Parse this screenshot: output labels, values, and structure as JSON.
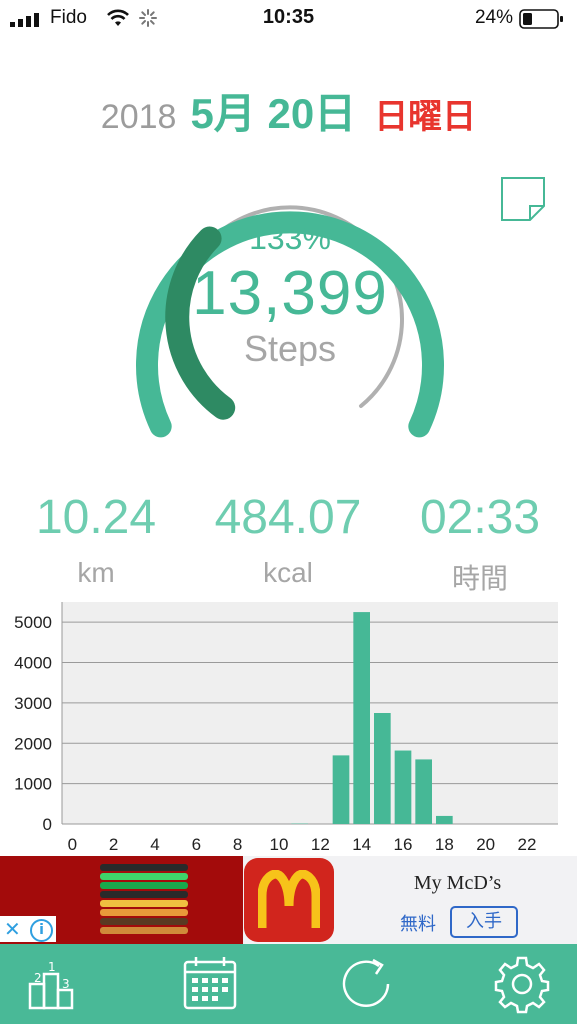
{
  "status_bar": {
    "carrier": "Fido",
    "time": "10:35",
    "battery": "24%"
  },
  "header": {
    "year": "2018",
    "month_day": "5月 20日",
    "weekday": "日曜日"
  },
  "gauge": {
    "percent": "133%",
    "steps": "13,399",
    "steps_label": "Steps",
    "progress": 1.33
  },
  "stats": {
    "distance": {
      "value": "10.24",
      "unit": "km"
    },
    "calories": {
      "value": "484.07",
      "unit": "kcal"
    },
    "duration": {
      "value": "02:33",
      "unit": "時間"
    }
  },
  "chart_data": {
    "type": "bar",
    "x": [
      0,
      1,
      2,
      3,
      4,
      5,
      6,
      7,
      8,
      9,
      10,
      11,
      12,
      13,
      14,
      15,
      16,
      17,
      18,
      19,
      20,
      21,
      22,
      23
    ],
    "values": [
      0,
      0,
      0,
      0,
      0,
      0,
      0,
      0,
      0,
      0,
      0,
      10,
      0,
      1700,
      5250,
      2750,
      1820,
      1600,
      200,
      0,
      0,
      0,
      0,
      0
    ],
    "x_ticks": [
      "0",
      "2",
      "4",
      "6",
      "8",
      "10",
      "12",
      "14",
      "16",
      "18",
      "20",
      "22"
    ],
    "y_ticks": [
      "0",
      "1000",
      "2000",
      "3000",
      "4000",
      "5000"
    ],
    "ylim": [
      0,
      5500
    ],
    "grid": true,
    "bar_color": "#46b896"
  },
  "ad": {
    "title": "My McD’s",
    "free_label": "無料",
    "install_label": "入手"
  },
  "tabs": [
    {
      "icon": "ranking-icon"
    },
    {
      "icon": "calendar-icon"
    },
    {
      "icon": "refresh-icon"
    },
    {
      "icon": "gear-icon"
    }
  ],
  "colors": {
    "accent": "#46b896",
    "accent_dark": "#2e8a63",
    "weekday": "#e8352e",
    "tabbar": "#49b997"
  }
}
